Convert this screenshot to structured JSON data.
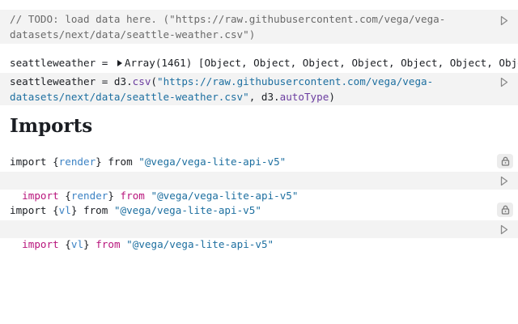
{
  "cells": {
    "todo": {
      "line1": "// TODO: load data here. (\"https://raw.githubusercontent.com/vega/vega-",
      "line2": "datasets/next/data/seattle-weather.csv\")"
    },
    "seattle_output": {
      "name": "seattleweather",
      "eq": " = ",
      "array_label": "Array(1461)",
      "preview": " [Object, Object, Object, Object, Object, Object, Object, Object, O"
    },
    "seattle_source": {
      "name": "seattleweather",
      "eq": " = ",
      "d3": "d3",
      "dot1": ".",
      "csv": "csv",
      "open": "(",
      "url_line1": "\"https://raw.githubusercontent.com/vega/vega-",
      "url_line2": "datasets/next/data/seattle-weather.csv\"",
      "comma": ", ",
      "d3b": "d3",
      "dot2": ".",
      "autotype": "autoType",
      "close": ")"
    },
    "heading": "Imports",
    "import_render_output": {
      "kw_import": "import ",
      "brace_open": "{",
      "name": "render",
      "brace_close": "}",
      "kw_from": " from ",
      "module": "\"@vega/vega-lite-api-v5\""
    },
    "import_render_source": {
      "kw_import": "import",
      "sp": " ",
      "brace_open": "{",
      "name": "render",
      "brace_close": "}",
      "kw_from": "from",
      "module": "\"@vega/vega-lite-api-v5\""
    },
    "import_vl_output": {
      "kw_import": "import ",
      "brace_open": "{",
      "name": "vl",
      "brace_close": "}",
      "kw_from": " from ",
      "module": "\"@vega/vega-lite-api-v5\""
    },
    "import_vl_source": {
      "kw_import": "import",
      "sp": " ",
      "brace_open": "{",
      "name": "vl",
      "brace_close": "}",
      "kw_from": "from",
      "module": "\"@vega/vega-lite-api-v5\""
    }
  },
  "icons": {
    "run": "play-icon",
    "lock": "lock-icon"
  },
  "colors": {
    "cell_bg": "#f3f3f3",
    "keyword": "#b8157c",
    "string": "#1d6fa0",
    "import_name": "#3b82c4",
    "member": "#6b3da0"
  }
}
